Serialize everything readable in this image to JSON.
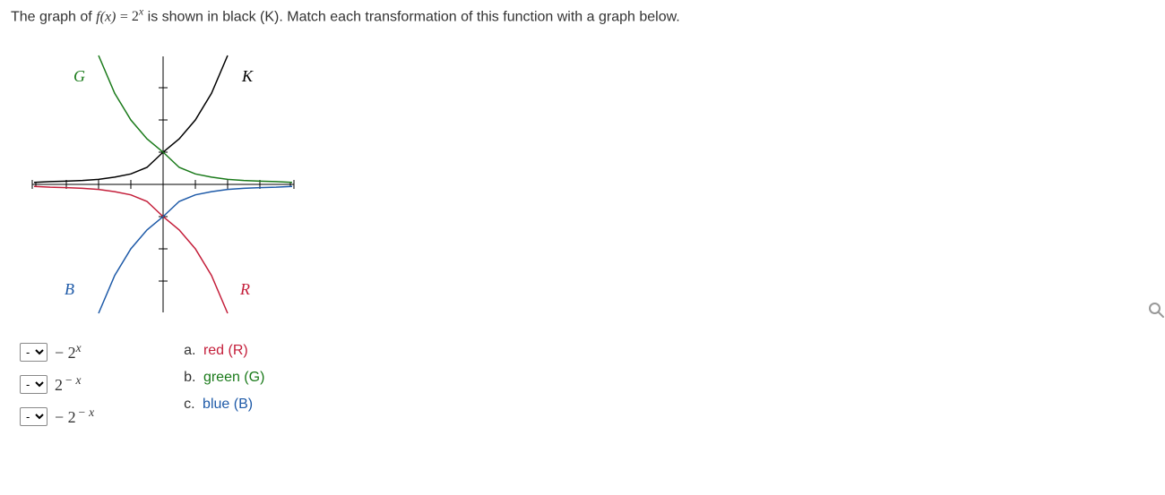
{
  "prompt": {
    "part1": "The graph of ",
    "fn_lhs": "f(x)",
    "eq": " = ",
    "fn_rhs_base": "2",
    "fn_rhs_exp": "x",
    "part2": " is shown in black (K). Match each transformation of this function with a graph below."
  },
  "graph_labels": {
    "K": "K",
    "G": "G",
    "R": "R",
    "B": "B"
  },
  "chart_data": {
    "type": "line",
    "xlim": [
      -4,
      4
    ],
    "ylim": [
      -4,
      4
    ],
    "series": [
      {
        "name": "K",
        "label": "K",
        "color": "#000000",
        "formula": "2^x"
      },
      {
        "name": "G",
        "label": "G",
        "color": "#1a7a1a",
        "formula": "2^(-x)"
      },
      {
        "name": "R",
        "label": "R",
        "color": "#c41e3a",
        "formula": "-2^x"
      },
      {
        "name": "B",
        "label": "B",
        "color": "#1e5aa8",
        "formula": "-2^(-x)"
      }
    ]
  },
  "dropdown_placeholder": "-",
  "questions": [
    {
      "expr_neg": "−",
      "expr_base": "2",
      "expr_sup": "x"
    },
    {
      "expr_neg": "",
      "expr_base": "2",
      "expr_sup": "− x"
    },
    {
      "expr_neg": "−",
      "expr_base": "2",
      "expr_sup": "− x"
    }
  ],
  "choices": [
    {
      "marker": "a.",
      "text": "red (R)",
      "class": "c-red"
    },
    {
      "marker": "b.",
      "text": "green (G)",
      "class": "c-green"
    },
    {
      "marker": "c.",
      "text": "blue (B)",
      "class": "c-blue"
    }
  ]
}
